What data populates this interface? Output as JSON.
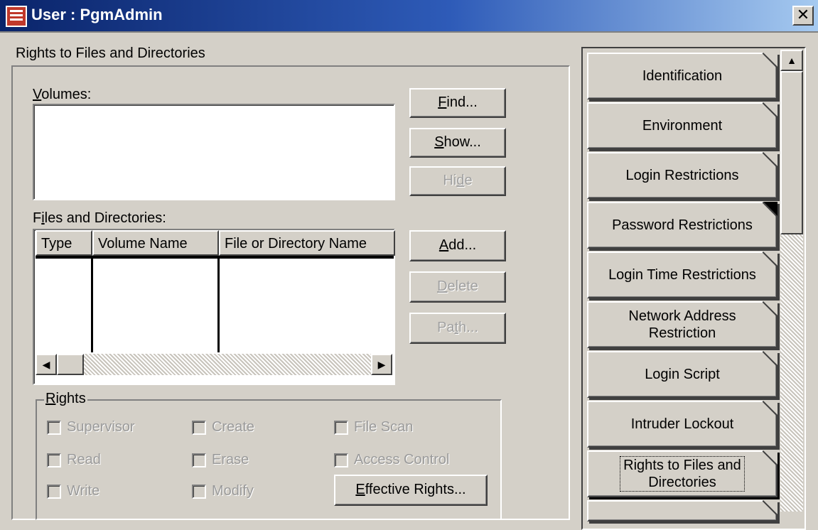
{
  "window": {
    "title": "User : PgmAdmin",
    "close_glyph": "✕"
  },
  "section": {
    "title": "Rights to Files and Directories"
  },
  "volumes": {
    "label_prefix": "",
    "label_mnemonic": "V",
    "label_rest": "olumes:",
    "items": []
  },
  "buttons": {
    "find": {
      "mn": "F",
      "rest": "ind..."
    },
    "show": {
      "mn": "S",
      "rest": "how..."
    },
    "hide": {
      "pre": "Hi",
      "mn": "d",
      "rest": "e"
    },
    "add": {
      "mn": "A",
      "rest": "dd..."
    },
    "delete": {
      "mn": "D",
      "rest": "elete"
    },
    "path": {
      "pre": "Pa",
      "mn": "t",
      "rest": "h..."
    },
    "effective": {
      "mn": "E",
      "rest": "ffective Rights..."
    }
  },
  "files": {
    "label_pre": "F",
    "label_mn": "i",
    "label_rest": "les and Directories:",
    "columns": [
      "Type",
      "Volume Name",
      "File or Directory Name"
    ],
    "rows": []
  },
  "rights": {
    "legend_mn": "R",
    "legend_rest": "ights",
    "checkboxes": [
      {
        "label": "Supervisor",
        "checked": false
      },
      {
        "label": "Create",
        "checked": false
      },
      {
        "label": "File Scan",
        "checked": false
      },
      {
        "label": "Read",
        "checked": false
      },
      {
        "label": "Erase",
        "checked": false
      },
      {
        "label": "Access Control",
        "checked": false
      },
      {
        "label": "Write",
        "checked": false
      },
      {
        "label": "Modify",
        "checked": false
      }
    ]
  },
  "pages": [
    {
      "label": "Identification"
    },
    {
      "label": "Environment"
    },
    {
      "label": "Login Restrictions"
    },
    {
      "label": "Password Restrictions"
    },
    {
      "label": "Login Time Restrictions"
    },
    {
      "label": "Network Address Restriction",
      "line1": "Network Address",
      "line2": "Restriction"
    },
    {
      "label": "Login Script"
    },
    {
      "label": "Intruder Lockout"
    },
    {
      "label": "Rights to Files and Directories",
      "line1": "Rights to Files and",
      "line2": "Directories"
    }
  ],
  "scroll": {
    "left_glyph": "◀",
    "right_glyph": "▶",
    "up_glyph": "▲"
  }
}
